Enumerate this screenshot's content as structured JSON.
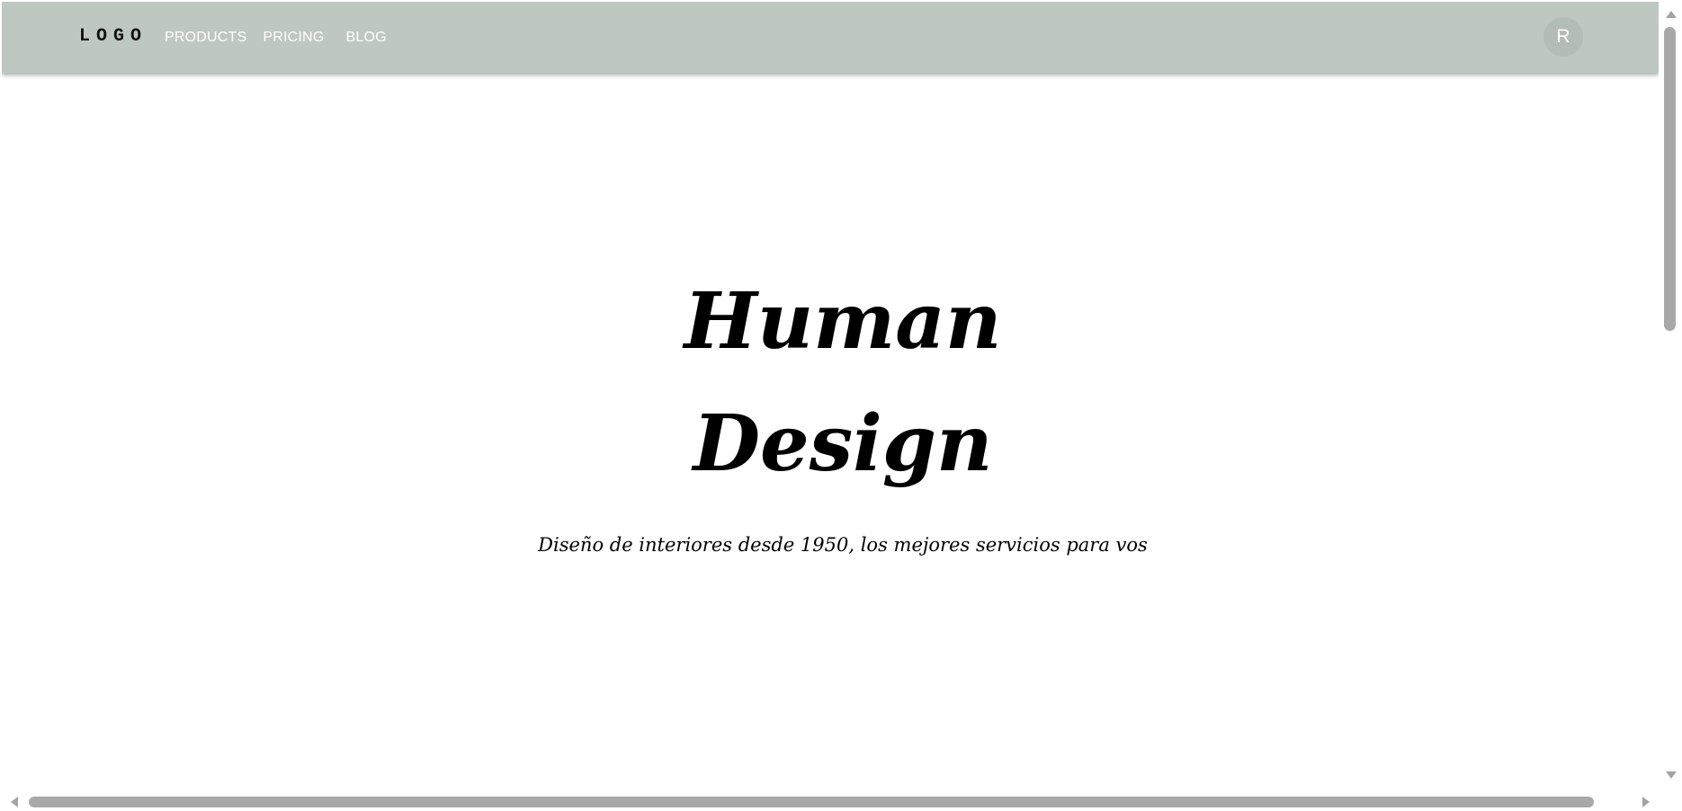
{
  "appbar": {
    "logo": "LOGO",
    "nav": [
      {
        "label": "PRODUCTS"
      },
      {
        "label": "PRICING"
      },
      {
        "label": "BLOG"
      }
    ],
    "avatar_initial": "R",
    "background": "#bec8c1"
  },
  "hero": {
    "title_line1": "Human",
    "title_line2": "Design",
    "subtitle": "Diseño de interiores desde 1950, los mejores servicios para vos"
  }
}
